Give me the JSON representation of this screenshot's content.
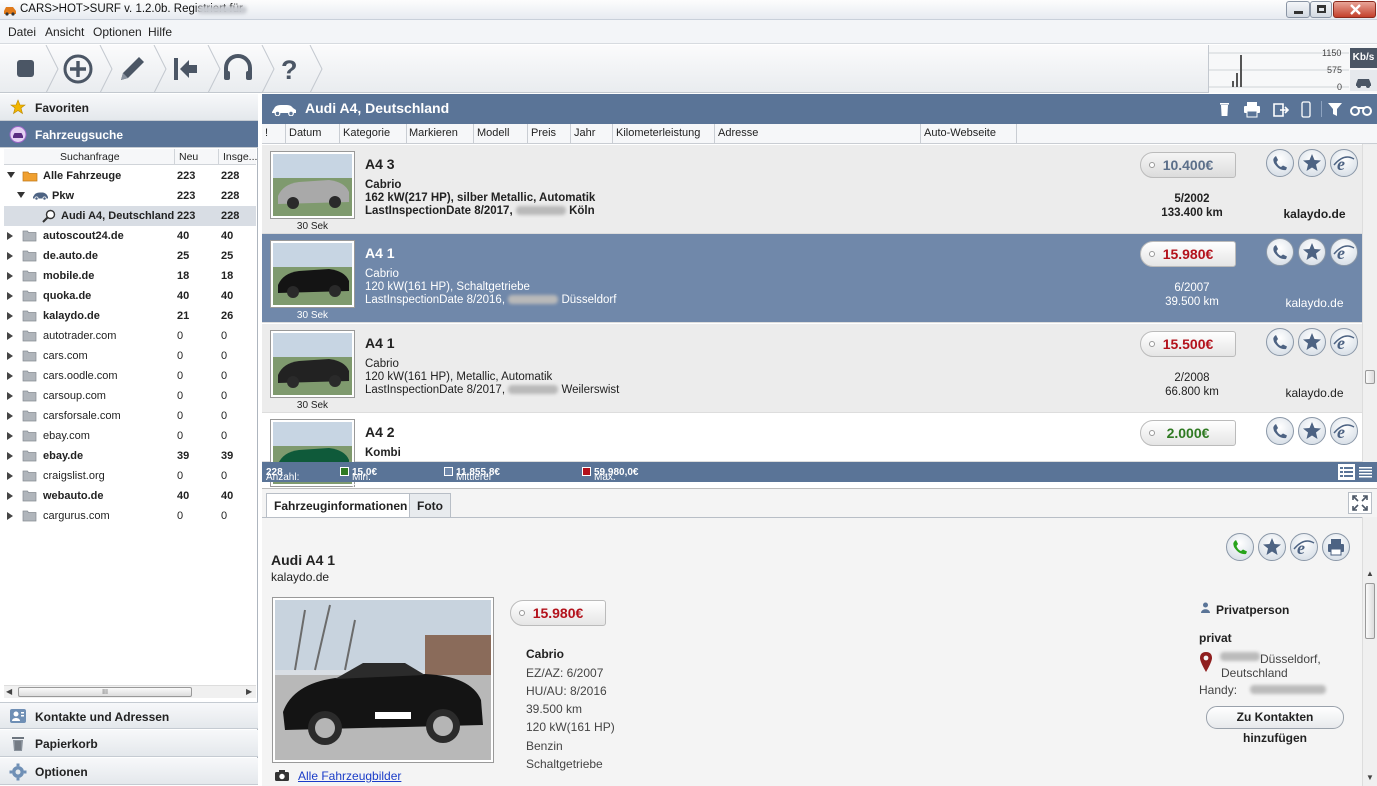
{
  "window": {
    "title": "CARS>HOT>SURF v. 1.2.0b. Registriert für"
  },
  "menu": {
    "items": [
      "Datei",
      "Ansicht",
      "Optionen",
      "Hilfe"
    ]
  },
  "speed": {
    "max": "1150",
    "mid": "575",
    "min": "0",
    "unit": "Kb/s"
  },
  "sidebar": {
    "favoriten": "Favoriten",
    "fahrzeugsuche": "Fahrzeugsuche",
    "cols": [
      "Suchanfrage",
      "Neu",
      "Insge..."
    ],
    "rows": [
      {
        "name": "Alle Fahrzeuge",
        "neu": "223",
        "ges": "228",
        "bold": true,
        "level": 0,
        "expanded": true,
        "icon": "car-folder-icon"
      },
      {
        "name": "Pkw",
        "neu": "223",
        "ges": "228",
        "bold": true,
        "level": 1,
        "expanded": true,
        "icon": "car-icon"
      },
      {
        "name": "Audi A4, Deutschland",
        "neu": "223",
        "ges": "228",
        "bold": true,
        "level": 2,
        "selected": true,
        "icon": "magnifier-icon"
      },
      {
        "name": "autoscout24.de",
        "neu": "40",
        "ges": "40",
        "bold": true
      },
      {
        "name": "de.auto.de",
        "neu": "25",
        "ges": "25",
        "bold": true
      },
      {
        "name": "mobile.de",
        "neu": "18",
        "ges": "18",
        "bold": true
      },
      {
        "name": "quoka.de",
        "neu": "40",
        "ges": "40",
        "bold": true
      },
      {
        "name": "kalaydo.de",
        "neu": "21",
        "ges": "26",
        "bold": true
      },
      {
        "name": "autotrader.com",
        "neu": "0",
        "ges": "0"
      },
      {
        "name": "cars.com",
        "neu": "0",
        "ges": "0"
      },
      {
        "name": "cars.oodle.com",
        "neu": "0",
        "ges": "0"
      },
      {
        "name": "carsoup.com",
        "neu": "0",
        "ges": "0"
      },
      {
        "name": "carsforsale.com",
        "neu": "0",
        "ges": "0"
      },
      {
        "name": "ebay.com",
        "neu": "0",
        "ges": "0"
      },
      {
        "name": "ebay.de",
        "neu": "39",
        "ges": "39",
        "bold": true
      },
      {
        "name": "craigslist.org",
        "neu": "0",
        "ges": "0"
      },
      {
        "name": "webauto.de",
        "neu": "40",
        "ges": "40",
        "bold": true
      },
      {
        "name": "cargurus.com",
        "neu": "0",
        "ges": "0"
      }
    ],
    "hscroll": "III",
    "kontakte": "Kontakte und Adressen",
    "papierkorb": "Papierkorb",
    "optionen": "Optionen"
  },
  "main": {
    "title": "Audi A4, Deutschland",
    "columns": [
      "!",
      "Datum",
      "Kategorie",
      "Markieren",
      "Modell",
      "Preis",
      "Jahr",
      "Kilometerleistung",
      "Adresse",
      "Auto-Webseite"
    ],
    "cards": [
      {
        "model": "A4 3",
        "cat": "Cabrio",
        "spec": "162 kW(217 HP), silber Metallic, Automatik",
        "insp": "LastInspectionDate 8/2017,",
        "city": "Köln",
        "price": "10.400€",
        "date": "5/2002",
        "km": "133.400 km",
        "site": "kalaydo.de",
        "sek": "30 Sek"
      },
      {
        "model": "A4 1",
        "cat": "Cabrio",
        "spec": "120 kW(161 HP), Schaltgetriebe",
        "insp": "LastInspectionDate 8/2016,",
        "city": "Düsseldorf",
        "price": "15.980€",
        "date": "6/2007",
        "km": "39.500 km",
        "site": "kalaydo.de",
        "sek": "30 Sek"
      },
      {
        "model": "A4 1",
        "cat": "Cabrio",
        "spec": "120 kW(161 HP),  Metallic, Automatik",
        "insp": "LastInspectionDate 8/2017,",
        "city": "Weilerswist",
        "price": "15.500€",
        "date": "2/2008",
        "km": "66.800 km",
        "site": "kalaydo.de",
        "sek": "30 Sek"
      },
      {
        "model": "A4 2",
        "cat": "Kombi",
        "price": "2.000€"
      }
    ]
  },
  "stats": {
    "anzahl_label": "Anzahl:",
    "anzahl": "228",
    "min_label": "Min. Preis:",
    "min": "15,0€",
    "mid_label": "Mittlerer Preis:",
    "mid": "11.855,8€",
    "max_label": "Max. Preis:",
    "max": "59.980,0€"
  },
  "detail": {
    "tabs": [
      "Fahrzeuginformationen",
      "Foto"
    ],
    "title": "Audi A4 1",
    "site": "kalaydo.de",
    "price": "15.980€",
    "cat": "Cabrio",
    "ez": "EZ/AZ: 6/2007",
    "hu": "HU/AU: 8/2016",
    "km": "39.500 km",
    "power": "120 kW(161 HP)",
    "fuel": "Benzin",
    "gear": "Schaltgetriebe",
    "all_images": "Alle Fahrzeugbilder",
    "seller_type": "Privatperson",
    "seller": "privat",
    "city": "Düsseldorf,",
    "country": "Deutschland",
    "handy_label": "Handy:",
    "add_contact": "Zu Kontakten hinzufügen"
  },
  "colors": {
    "accent": "#5a7497",
    "selected": "#7088aa",
    "price_red": "#b3111b",
    "price_green": "#2f7a22"
  }
}
